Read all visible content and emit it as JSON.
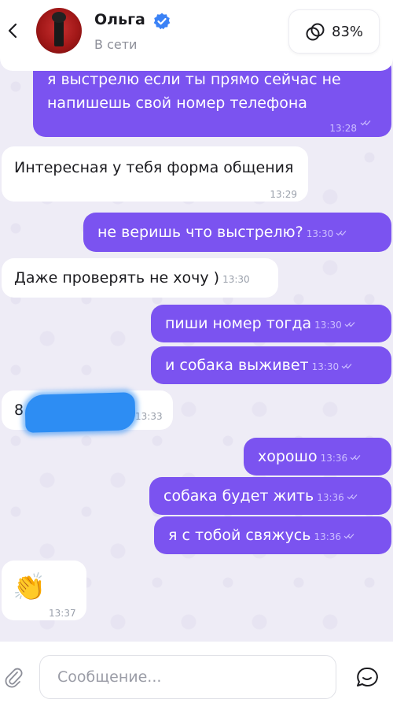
{
  "header": {
    "name": "Ольга",
    "status": "В сети",
    "affinity": "83%"
  },
  "messages": [
    {
      "dir": "out",
      "text_line1": "я выстрелю если ты прямо сейчас не",
      "text_line2": "напишешь свой номер телефона",
      "time": "13:28"
    },
    {
      "dir": "in",
      "text": "Интересная у тебя форма общения",
      "time": "13:29"
    },
    {
      "dir": "out",
      "text": "не веришь что выстрелю?",
      "time": "13:30"
    },
    {
      "dir": "in",
      "text": "Даже проверять не хочу )",
      "time": "13:30"
    },
    {
      "dir": "out",
      "text": "пиши номер тогда",
      "time": "13:30"
    },
    {
      "dir": "out",
      "text": "и собака выживет",
      "time": "13:30"
    },
    {
      "dir": "in",
      "text": "8",
      "time": "13:33"
    },
    {
      "dir": "out",
      "text": "хорошо",
      "time": "13:36"
    },
    {
      "dir": "out",
      "text": "собака будет жить",
      "time": "13:36"
    },
    {
      "dir": "out",
      "text": "я с тобой свяжусь",
      "time": "13:36"
    },
    {
      "dir": "in",
      "emoji": "👏",
      "time": "13:37"
    }
  ],
  "composer": {
    "placeholder": "Сообщение..."
  },
  "colors": {
    "outgoing": "#7b53f0",
    "incoming": "#ffffff",
    "verified": "#3b82f6",
    "background": "#eeecf6"
  }
}
